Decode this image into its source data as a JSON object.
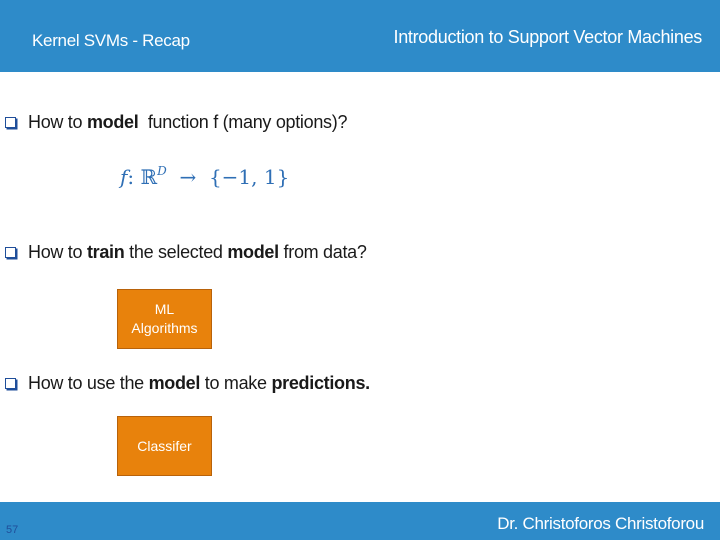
{
  "header": {
    "left_title": "Kernel SVMs - Recap",
    "right_title": "Introduction to Support Vector Machines"
  },
  "bullets": [
    {
      "parts": [
        "How to ",
        "model",
        "  function f (many options)?"
      ]
    },
    {
      "parts": [
        "How to ",
        "train",
        " the selected ",
        "model",
        " from data?"
      ]
    },
    {
      "parts": [
        "How to use the ",
        "model",
        " to make ",
        "predictions."
      ]
    }
  ],
  "formula": {
    "f": "f",
    "colon_space": ": ",
    "reals": "ℝ",
    "superscript": "D",
    "arrow": "  →  ",
    "set": "{−1, 1}"
  },
  "boxes": {
    "ml_line1": "ML",
    "ml_line2": "Algorithms",
    "classifier": "Classifer"
  },
  "footer": {
    "author": "Dr. Christoforos Christoforou",
    "page_number": "57"
  },
  "colors": {
    "header_bar": "#2E8BC9",
    "box_fill": "#E8820C",
    "formula": "#2F6FB5"
  }
}
